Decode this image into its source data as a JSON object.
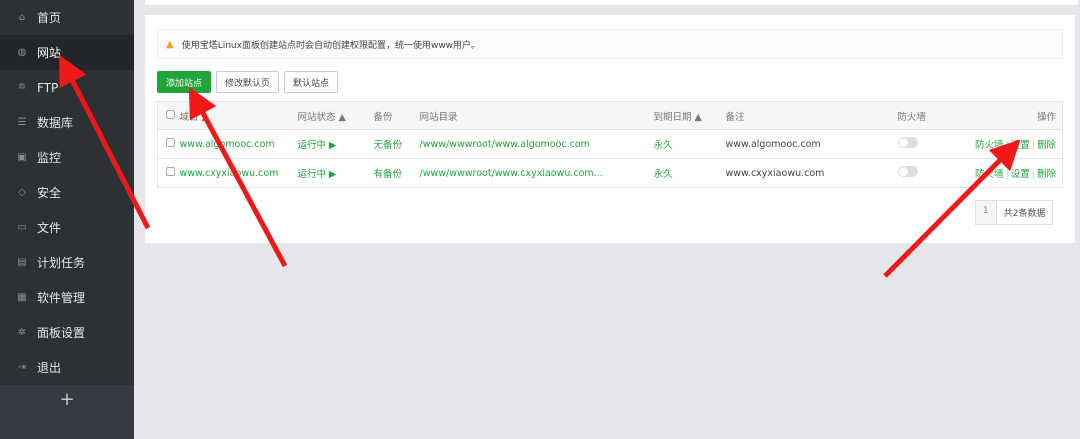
{
  "sidebar": {
    "items": [
      {
        "label": "首页",
        "icon": "home-icon"
      },
      {
        "label": "网站",
        "icon": "globe-icon"
      },
      {
        "label": "FTP",
        "icon": "ftp-icon"
      },
      {
        "label": "数据库",
        "icon": "database-icon"
      },
      {
        "label": "监控",
        "icon": "monitor-icon"
      },
      {
        "label": "安全",
        "icon": "shield-icon"
      },
      {
        "label": "文件",
        "icon": "folder-icon"
      },
      {
        "label": "计划任务",
        "icon": "calendar-icon"
      },
      {
        "label": "软件管理",
        "icon": "grid-icon"
      },
      {
        "label": "面板设置",
        "icon": "gear-icon"
      },
      {
        "label": "退出",
        "icon": "logout-icon"
      }
    ],
    "add": "+"
  },
  "notice": "使用宝塔Linux面板创建站点时会自动创建权限配置，统一使用www用户。",
  "buttons": {
    "add_site": "添加站点",
    "edit_default": "修改默认页",
    "default_site": "默认站点"
  },
  "table": {
    "headers": {
      "domain": "域名",
      "status": "网站状态",
      "backup": "备份",
      "dir": "网站目录",
      "expire": "到期日期",
      "note": "备注",
      "firewall": "防火墙",
      "ops": "操作"
    },
    "rows": [
      {
        "domain": "www.algomooc.com",
        "status": "运行中 ▶",
        "backup": "无备份",
        "dir": "/www/wwwroot/www.algomooc.com",
        "expire": "永久",
        "note": "www.algomooc.com"
      },
      {
        "domain": "www.cxyxiaowu.com",
        "status": "运行中 ▶",
        "backup": "有备份",
        "dir": "/www/wwwroot/www.cxyxiaowu.com...",
        "expire": "永久",
        "note": "www.cxyxiaowu.com"
      }
    ],
    "ops": {
      "firewall": "防火墙",
      "settings": "设置",
      "delete": "删除"
    }
  },
  "pager": {
    "page": "1",
    "total": "共2条数据"
  }
}
